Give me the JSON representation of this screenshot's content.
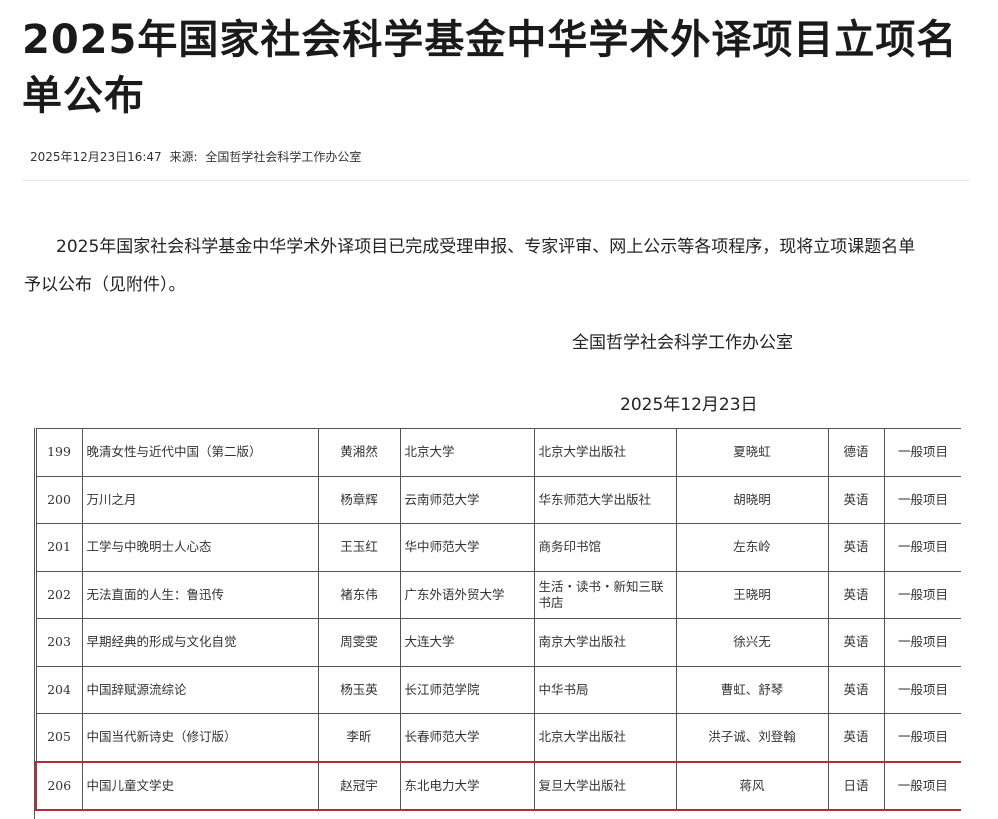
{
  "article": {
    "title": "2025年国家社会科学基金中华学术外译项目立项名单公布",
    "datetime": "2025年12月23日16:47",
    "source_label": "来源:",
    "source_name": "全国哲学社会科学工作办公室",
    "body_line1": "2025年国家社会科学基金中华学术外译项目已完成受理申报、专家评审、网上公示等各项程序，现将立项课题名单",
    "body_line2": "予以公布（见附件）。",
    "signature": "全国哲学社会科学工作办公室",
    "date": "2025年12月23日"
  },
  "table": {
    "rows": [
      {
        "no": "199",
        "title": "晚清女性与近代中国（第二版）",
        "author": "黄湘然",
        "unit": "北京大学",
        "publisher": "北京大学出版社",
        "translator": "夏晓虹",
        "language": "德语",
        "type": "一般项目",
        "highlight": false
      },
      {
        "no": "200",
        "title": "万川之月",
        "author": "杨章辉",
        "unit": "云南师范大学",
        "publisher": "华东师范大学出版社",
        "translator": "胡晓明",
        "language": "英语",
        "type": "一般项目",
        "highlight": false
      },
      {
        "no": "201",
        "title": "工学与中晚明士人心态",
        "author": "王玉红",
        "unit": "华中师范大学",
        "publisher": "商务印书馆",
        "translator": "左东岭",
        "language": "英语",
        "type": "一般项目",
        "highlight": false
      },
      {
        "no": "202",
        "title": "无法直面的人生：鲁迅传",
        "author": "褚东伟",
        "unit": "广东外语外贸大学",
        "publisher": "生活・读书・新知三联书店",
        "translator": "王晓明",
        "language": "英语",
        "type": "一般项目",
        "highlight": false
      },
      {
        "no": "203",
        "title": "早期经典的形成与文化自觉",
        "author": "周雯雯",
        "unit": "大连大学",
        "publisher": "南京大学出版社",
        "translator": "徐兴无",
        "language": "英语",
        "type": "一般项目",
        "highlight": false
      },
      {
        "no": "204",
        "title": "中国辞赋源流综论",
        "author": "杨玉英",
        "unit": "长江师范学院",
        "publisher": "中华书局",
        "translator": "曹虹、舒琴",
        "language": "英语",
        "type": "一般项目",
        "highlight": false
      },
      {
        "no": "205",
        "title": "中国当代新诗史（修订版）",
        "author": "李昕",
        "unit": "长春师范大学",
        "publisher": "北京大学出版社",
        "translator": "洪子诚、刘登翰",
        "language": "英语",
        "type": "一般项目",
        "highlight": false
      },
      {
        "no": "206",
        "title": "中国儿童文学史",
        "author": "赵冠宇",
        "unit": "东北电力大学",
        "publisher": "复旦大学出版社",
        "translator": "蒋风",
        "language": "日语",
        "type": "一般项目",
        "highlight": true
      }
    ]
  }
}
